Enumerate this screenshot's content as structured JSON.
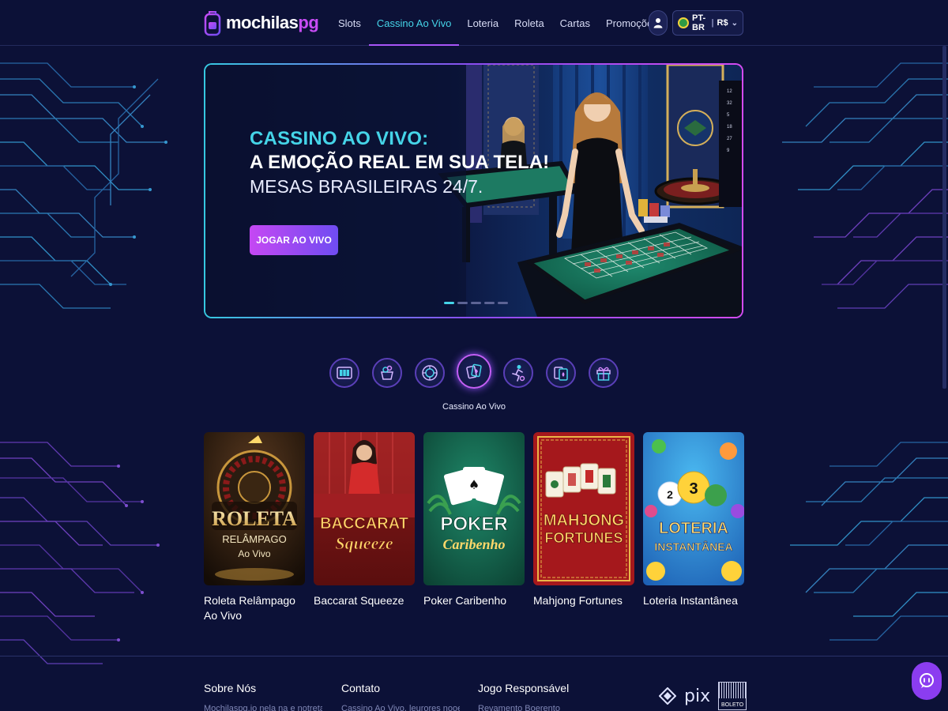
{
  "brand": {
    "name_main": "mochilas",
    "name_accent": "pg"
  },
  "nav": {
    "items": [
      {
        "label": "Slots",
        "active": false
      },
      {
        "label": "Cassino Ao Vivo",
        "active": true
      },
      {
        "label": "Loteria",
        "active": false
      },
      {
        "label": "Roleta",
        "active": false
      },
      {
        "label": "Cartas",
        "active": false
      },
      {
        "label": "Promoções",
        "active": false
      }
    ]
  },
  "header": {
    "user_icon": "user-icon",
    "language": "PT-BR",
    "currency": "R$",
    "language_chevron": "chevron-down-icon"
  },
  "hero": {
    "title_line1": "CASSINO AO VIVO:",
    "title_line2": "A EMOÇÃO REAL EM SUA TELA!",
    "title_line3": "MESAS BRASILEIRAS 24/7.",
    "cta_label": "JOGAR AO VIVO",
    "slides_total": 5,
    "active_slide": 1
  },
  "categories": {
    "items": [
      {
        "icon": "slot-machine-icon",
        "active": false
      },
      {
        "icon": "lottery-pot-icon",
        "active": false
      },
      {
        "icon": "roulette-icon",
        "active": false
      },
      {
        "icon": "live-cards-icon",
        "active": true
      },
      {
        "icon": "sports-player-icon",
        "active": false
      },
      {
        "icon": "playing-cards-icon",
        "active": false
      },
      {
        "icon": "gift-icon",
        "active": false
      }
    ],
    "active_label": "Cassino Ao Vivo"
  },
  "games": [
    {
      "title": "Roleta Relâmpago Ao Vivo",
      "art_text": [
        "ROLETA",
        "RELÂMPAGO",
        "Ao Vivo"
      ]
    },
    {
      "title": "Baccarat Squeeze",
      "art_text": [
        "BACCARAT",
        "Squeeze"
      ]
    },
    {
      "title": "Poker Caribenho",
      "art_text": [
        "POKER",
        "Caribenho"
      ]
    },
    {
      "title": "Mahjong Fortunes",
      "art_text": [
        "MAHJONG",
        "FORTUNES"
      ]
    },
    {
      "title": "Loteria Instantânea",
      "art_text": [
        "LOTERIA",
        "INSTANTÂNEA"
      ]
    }
  ],
  "footer": {
    "columns": [
      {
        "heading": "Sobre Nós",
        "text": "Mochilaspg.io nela na e notreta de"
      },
      {
        "heading": "Contato",
        "text": "Cassino Ao Vivo, leurores nooenos"
      },
      {
        "heading": "Jogo Responsável",
        "text": "Revamento Boerento"
      }
    ],
    "payments": {
      "pix": "pix",
      "boleto": "BOLETO"
    }
  },
  "colors": {
    "background": "#0c1137",
    "accent_cyan": "#45d4e8",
    "accent_purple": "#a855f7",
    "cta_gradient_start": "#c548f3",
    "cta_gradient_end": "#6f4cf2"
  }
}
